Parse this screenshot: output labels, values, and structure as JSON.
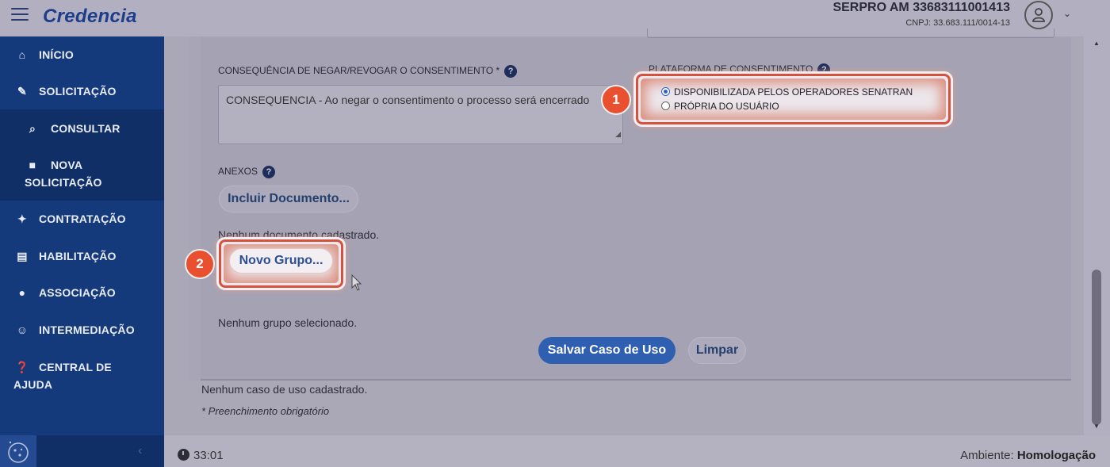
{
  "header": {
    "logo": "Credencia",
    "org_name": "SERPRO AM 33683111001413",
    "org_cnpj": "CNPJ: 33.683.111/0014-13"
  },
  "sidebar": {
    "items": [
      {
        "label": "INÍCIO",
        "icon": "home-icon"
      },
      {
        "label": "SOLICITAÇÃO",
        "icon": "edit-document-icon"
      },
      {
        "label": "CONSULTAR",
        "icon": "search-icon"
      },
      {
        "label": "NOVA",
        "label2": "SOLICITAÇÃO",
        "icon": "file-icon"
      },
      {
        "label": "CONTRATAÇÃO",
        "icon": "handshake-icon"
      },
      {
        "label": "HABILITAÇÃO",
        "icon": "id-card-icon"
      },
      {
        "label": "ASSOCIAÇÃO",
        "icon": "users-icon"
      },
      {
        "label": "INTERMEDIAÇÃO",
        "icon": "hand-user-icon"
      },
      {
        "label": "CENTRAL DE",
        "label2": "AJUDA",
        "icon": "question-circle-icon"
      }
    ]
  },
  "form": {
    "consequence_label": "CONSEQUÊNCIA DE NEGAR/REVOGAR O CONSENTIMENTO *",
    "consequence_value": "CONSEQUENCIA - Ao negar o consentimento o processo será encerrado",
    "platform_label": "PLATAFORMA DE CONSENTIMENTO",
    "platform_options": [
      "DISPONIBILIZADA PELOS OPERADORES SENATRAN",
      "PRÓPRIA DO USUÁRIO"
    ],
    "platform_selected": "DISPONIBILIZADA PELOS OPERADORES SENATRAN",
    "attachments_label": "ANEXOS",
    "include_document_button": "Incluir Documento...",
    "no_document": "Nenhum documento cadastrado.",
    "new_group_button": "Novo Grupo...",
    "no_group": "Nenhum grupo selecionado.",
    "save_button": "Salvar Caso de Uso",
    "clear_button": "Limpar",
    "no_use_case": "Nenhum caso de uso cadastrado.",
    "required_note": "* Preenchimento obrigatório",
    "help_symbol": "?"
  },
  "annotations": {
    "badge1": "1",
    "badge2": "2"
  },
  "footer": {
    "timer": "33:01",
    "env_label": "Ambiente:",
    "env_value": "Homologação"
  },
  "colors": {
    "sidebar": "#153a7c",
    "primary": "#2f5fb0",
    "highlight": "#d5523e",
    "badge": "#e8502f"
  }
}
